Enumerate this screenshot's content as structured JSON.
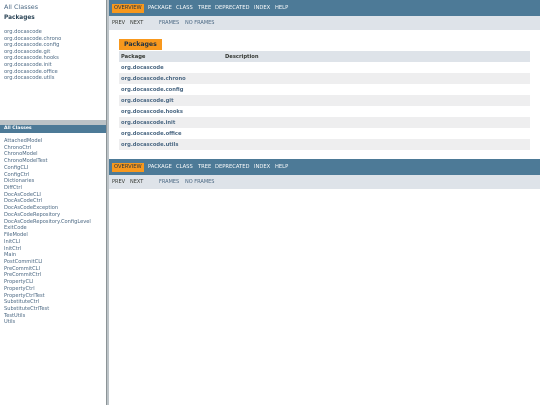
{
  "left_top": {
    "all_classes_link": "All Classes",
    "packages_heading": "Packages",
    "packages": [
      "org.docascode",
      "org.docascode.chrono",
      "org.docascode.config",
      "org.docascode.git",
      "org.docascode.hooks",
      "org.docascode.init",
      "org.docascode.office",
      "org.docascode.utils"
    ]
  },
  "left_bottom": {
    "heading": "All Classes",
    "classes": [
      "AttachedModel",
      "ChronoCtrl",
      "ChronoModel",
      "ChronoModelTest",
      "ConfigCLI",
      "ConfigCtrl",
      "Dictionaries",
      "DiffCtrl",
      "DocAsCodeCLI",
      "DocAsCodeCtrl",
      "DocAsCodeException",
      "DocAsCodeRepository",
      "DocAsCodeRepository.ConfigLevel",
      "ExitCode",
      "FileModel",
      "InitCLI",
      "InitCtrl",
      "Main",
      "PostCommitCLI",
      "PreCommitCLI",
      "PreCommitCtrl",
      "PropertyCLI",
      "PropertyCtrl",
      "PropertyCtrlTest",
      "SubstituteCtrl",
      "SubstituteCtrlTest",
      "TestUtils",
      "Utils"
    ]
  },
  "nav": {
    "items": [
      "OVERVIEW",
      "PACKAGE",
      "CLASS",
      "TREE",
      "DEPRECATED",
      "INDEX",
      "HELP"
    ],
    "active": "OVERVIEW",
    "sub": {
      "prev": "PREV",
      "next": "NEXT",
      "frames": "FRAMES",
      "no_frames": "NO FRAMES"
    }
  },
  "overview": {
    "caption": "Packages",
    "columns": {
      "package": "Package",
      "description": "Description"
    },
    "rows": [
      "org.docascode",
      "org.docascode.chrono",
      "org.docascode.config",
      "org.docascode.git",
      "org.docascode.hooks",
      "org.docascode.init",
      "org.docascode.office",
      "org.docascode.utils"
    ]
  },
  "colors": {
    "nav_bg": "#4d7a97",
    "active_tab": "#f8981d",
    "subnav_bg": "#dee3e9",
    "link": "#4a6782",
    "row_alt": "#eeeeef"
  }
}
